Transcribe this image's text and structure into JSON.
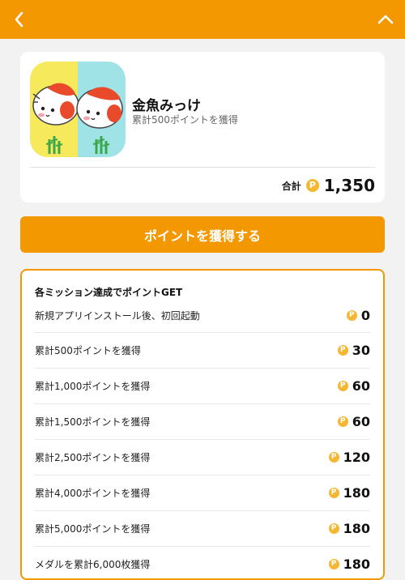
{
  "header": {
    "back_icon": "chevron-left-icon",
    "collapse_icon": "chevron-up-icon",
    "bg_color": "#f39800"
  },
  "app": {
    "name": "金魚みっけ",
    "subtitle": "累計500ポイントを獲得",
    "icon": "goldfish-app-icon"
  },
  "total": {
    "label": "合計",
    "coin": "P",
    "value": "1,350"
  },
  "cta": {
    "label": "ポイントを獲得する"
  },
  "missions": {
    "title": "各ミッション達成でポイントGET",
    "coin": "P",
    "items": [
      {
        "label": "新規アプリインストール後、初回起動",
        "points": "0"
      },
      {
        "label": "累計500ポイントを獲得",
        "points": "30"
      },
      {
        "label": "累計1,000ポイントを獲得",
        "points": "60"
      },
      {
        "label": "累計1,500ポイントを獲得",
        "points": "60"
      },
      {
        "label": "累計2,500ポイントを獲得",
        "points": "120"
      },
      {
        "label": "累計4,000ポイントを獲得",
        "points": "180"
      },
      {
        "label": "累計5,000ポイントを獲得",
        "points": "180"
      },
      {
        "label": "メダルを累計6,000枚獲得",
        "points": "180"
      }
    ]
  },
  "colors": {
    "accent": "#f39800",
    "coin": "#f5b731",
    "background": "#f2f2f2"
  }
}
